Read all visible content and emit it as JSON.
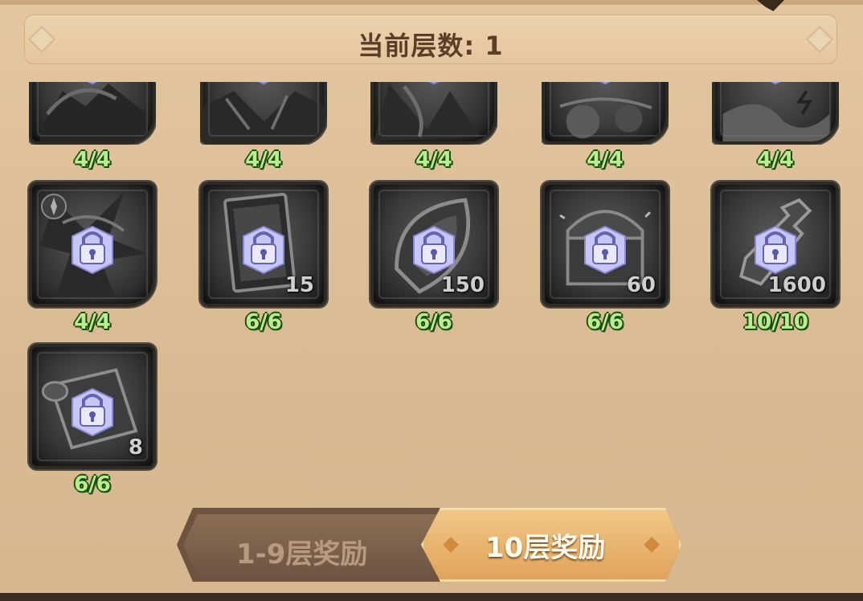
{
  "header": {
    "title": "当前层数: 1"
  },
  "rows": [
    {
      "items": [
        {
          "name": "hero-portrait",
          "count": "4/4",
          "qty": ""
        },
        {
          "name": "hero-portrait",
          "count": "4/4",
          "qty": ""
        },
        {
          "name": "hero-portrait",
          "count": "4/4",
          "qty": ""
        },
        {
          "name": "hero-portrait",
          "count": "4/4",
          "qty": ""
        },
        {
          "name": "hero-portrait",
          "count": "4/4",
          "qty": ""
        }
      ]
    },
    {
      "items": [
        {
          "name": "hero-portrait",
          "count": "4/4",
          "qty": ""
        },
        {
          "name": "card-item",
          "count": "6/6",
          "qty": "15"
        },
        {
          "name": "crystal-item",
          "count": "6/6",
          "qty": "150"
        },
        {
          "name": "chest-item",
          "count": "6/6",
          "qty": "60"
        },
        {
          "name": "potion-item",
          "count": "10/10",
          "qty": "1600"
        }
      ]
    },
    {
      "items": [
        {
          "name": "scroll-item",
          "count": "6/6",
          "qty": "8"
        }
      ]
    }
  ],
  "tabs": [
    {
      "label": "1-9层奖励",
      "active": false
    },
    {
      "label": "10层奖励",
      "active": true
    }
  ],
  "colors": {
    "background": "#dcc09b",
    "count_green": "#b8ee8c",
    "lock": "#c7c6f7",
    "active_tab": "#e0a25a"
  }
}
